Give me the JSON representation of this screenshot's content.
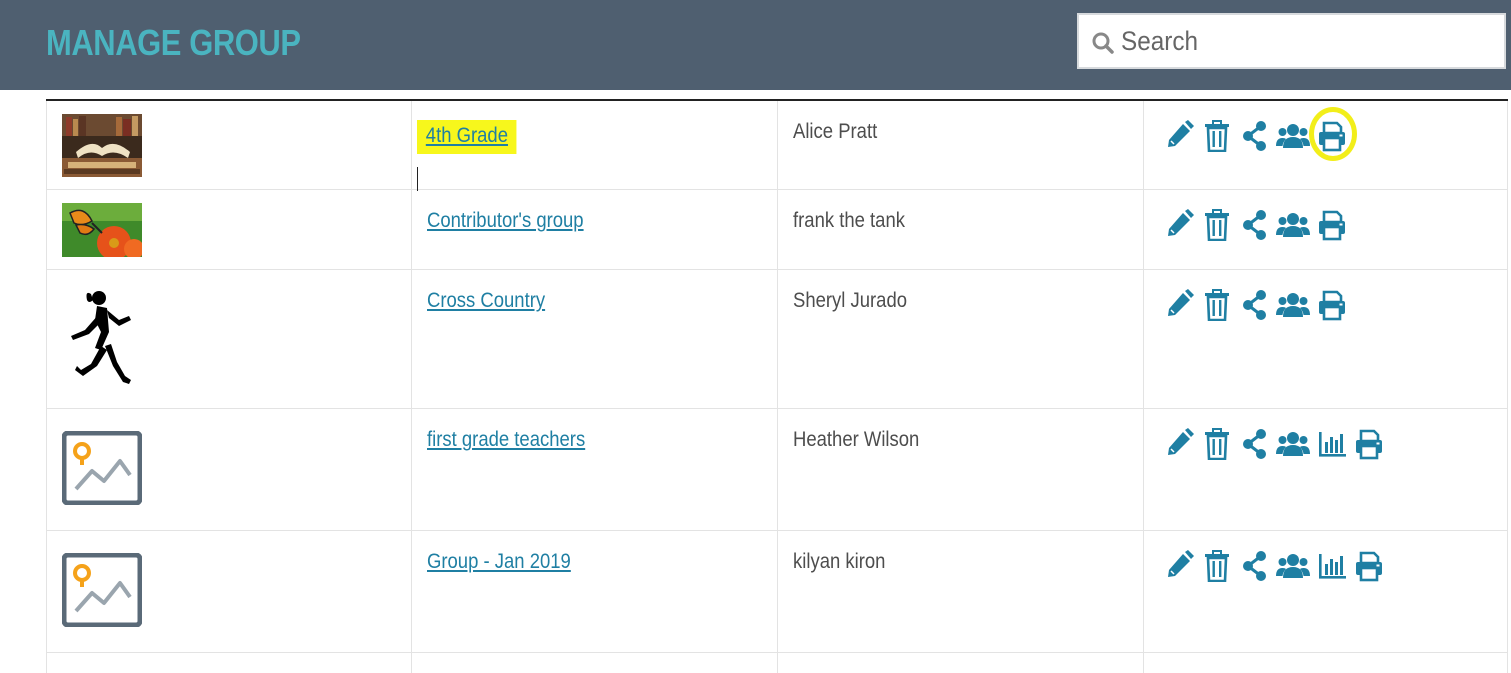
{
  "header": {
    "title": "MANAGE GROUP",
    "search_placeholder": "Search",
    "background_color": "#4f5f70",
    "title_color": "#4ab4c0"
  },
  "table": {
    "icon_color": "#1f7fa3",
    "link_color": "#1f7fa3",
    "rows": [
      {
        "thumbnail": "books-photo",
        "group": "4th Grade",
        "owner": "Alice Pratt",
        "actions": [
          "pencil-icon",
          "trash-icon",
          "share-icon",
          "users-icon",
          "print-icon"
        ],
        "highlighted": true
      },
      {
        "thumbnail": "butterfly-photo",
        "group": "Contributor's group",
        "owner": "frank the tank",
        "actions": [
          "pencil-icon",
          "trash-icon",
          "share-icon",
          "users-icon",
          "print-icon"
        ]
      },
      {
        "thumbnail": "runner-silhouette",
        "group": "Cross Country",
        "owner": "Sheryl Jurado",
        "actions": [
          "pencil-icon",
          "trash-icon",
          "share-icon",
          "users-icon",
          "print-icon"
        ]
      },
      {
        "thumbnail": "image-placeholder-icon",
        "group": "first grade teachers",
        "owner": "Heather Wilson",
        "actions": [
          "pencil-icon",
          "trash-icon",
          "share-icon",
          "users-icon",
          "bar-chart-icon",
          "print-icon"
        ]
      },
      {
        "thumbnail": "image-placeholder-icon",
        "group": "Group - Jan 2019",
        "owner": "kilyan kiron",
        "actions": [
          "pencil-icon",
          "trash-icon",
          "share-icon",
          "users-icon",
          "bar-chart-icon",
          "print-icon"
        ]
      }
    ]
  }
}
